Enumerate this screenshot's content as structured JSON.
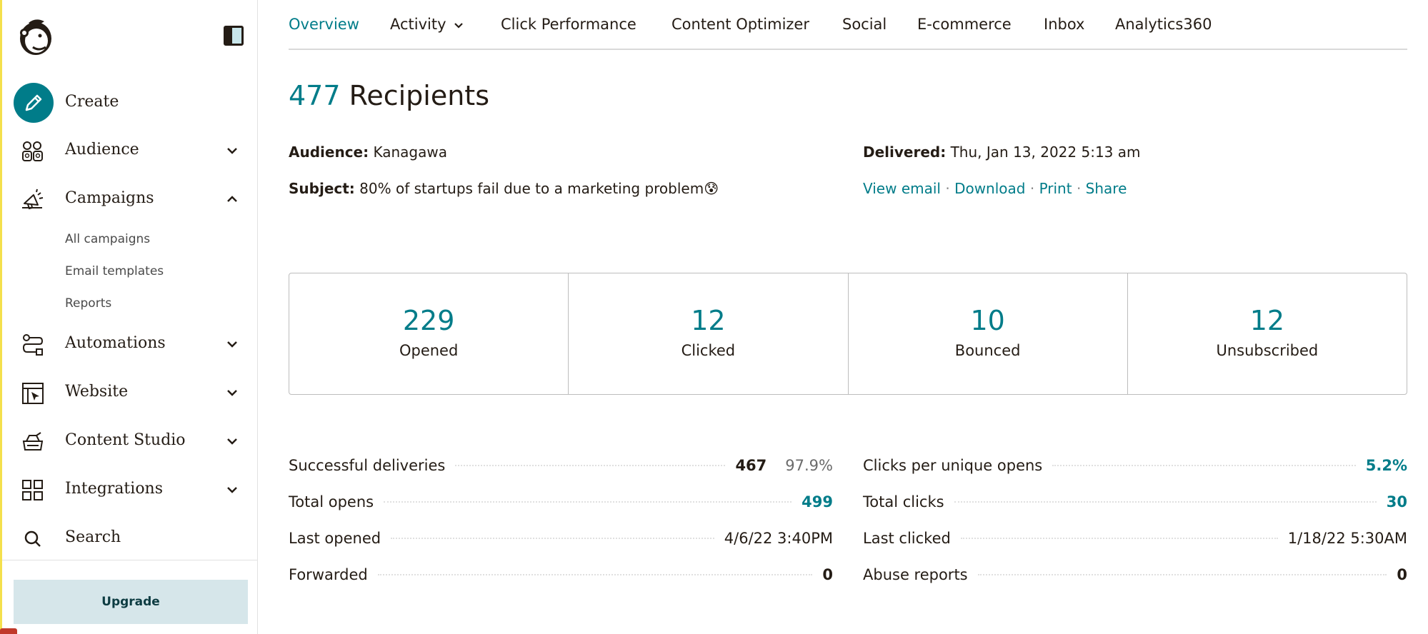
{
  "sidebar": {
    "create_label": "Create",
    "items": [
      {
        "label": "Audience",
        "icon": "audience-icon"
      },
      {
        "label": "Campaigns",
        "icon": "megaphone-icon"
      },
      {
        "label": "Automations",
        "icon": "automations-icon"
      },
      {
        "label": "Website",
        "icon": "website-icon"
      },
      {
        "label": "Content Studio",
        "icon": "content-studio-icon"
      },
      {
        "label": "Integrations",
        "icon": "grid-icon"
      },
      {
        "label": "Search",
        "icon": "search-icon"
      }
    ],
    "campaign_subitems": [
      "All campaigns",
      "Email templates",
      "Reports"
    ],
    "upgrade_label": "Upgrade"
  },
  "tabs": [
    "Overview",
    "Activity",
    "Click Performance",
    "Content Optimizer",
    "Social",
    "E-commerce",
    "Inbox",
    "Analytics360"
  ],
  "active_tab": "Overview",
  "header": {
    "recipient_count": "477",
    "recipient_label": "Recipients"
  },
  "meta": {
    "audience_label": "Audience:",
    "audience_value": "Kanagawa",
    "subject_label": "Subject:",
    "subject_value": "80% of startups fail due to a marketing problem😰",
    "delivered_label": "Delivered:",
    "delivered_value": "Thu, Jan 13, 2022 5:13 am",
    "links": [
      "View email",
      "Download",
      "Print",
      "Share"
    ],
    "link_separator": "·"
  },
  "stats": [
    {
      "value": "229",
      "label": "Opened"
    },
    {
      "value": "12",
      "label": "Clicked"
    },
    {
      "value": "10",
      "label": "Bounced"
    },
    {
      "value": "12",
      "label": "Unsubscribed"
    }
  ],
  "metrics_left": [
    {
      "label": "Successful deliveries",
      "value": "467",
      "pct": "97.9%"
    },
    {
      "label": "Total opens",
      "value": "499"
    },
    {
      "label": "Last opened",
      "value": "4/6/22 3:40PM"
    },
    {
      "label": "Forwarded",
      "value": "0"
    }
  ],
  "metrics_right": [
    {
      "label": "Clicks per unique opens",
      "value": "5.2%"
    },
    {
      "label": "Total clicks",
      "value": "30"
    },
    {
      "label": "Last clicked",
      "value": "1/18/22 5:30AM"
    },
    {
      "label": "Abuse reports",
      "value": "0"
    }
  ],
  "colors": {
    "accent": "#007c89",
    "text": "#241c15",
    "upgrade_bg": "#d6e6ea",
    "stripe": "#f4e04d"
  }
}
